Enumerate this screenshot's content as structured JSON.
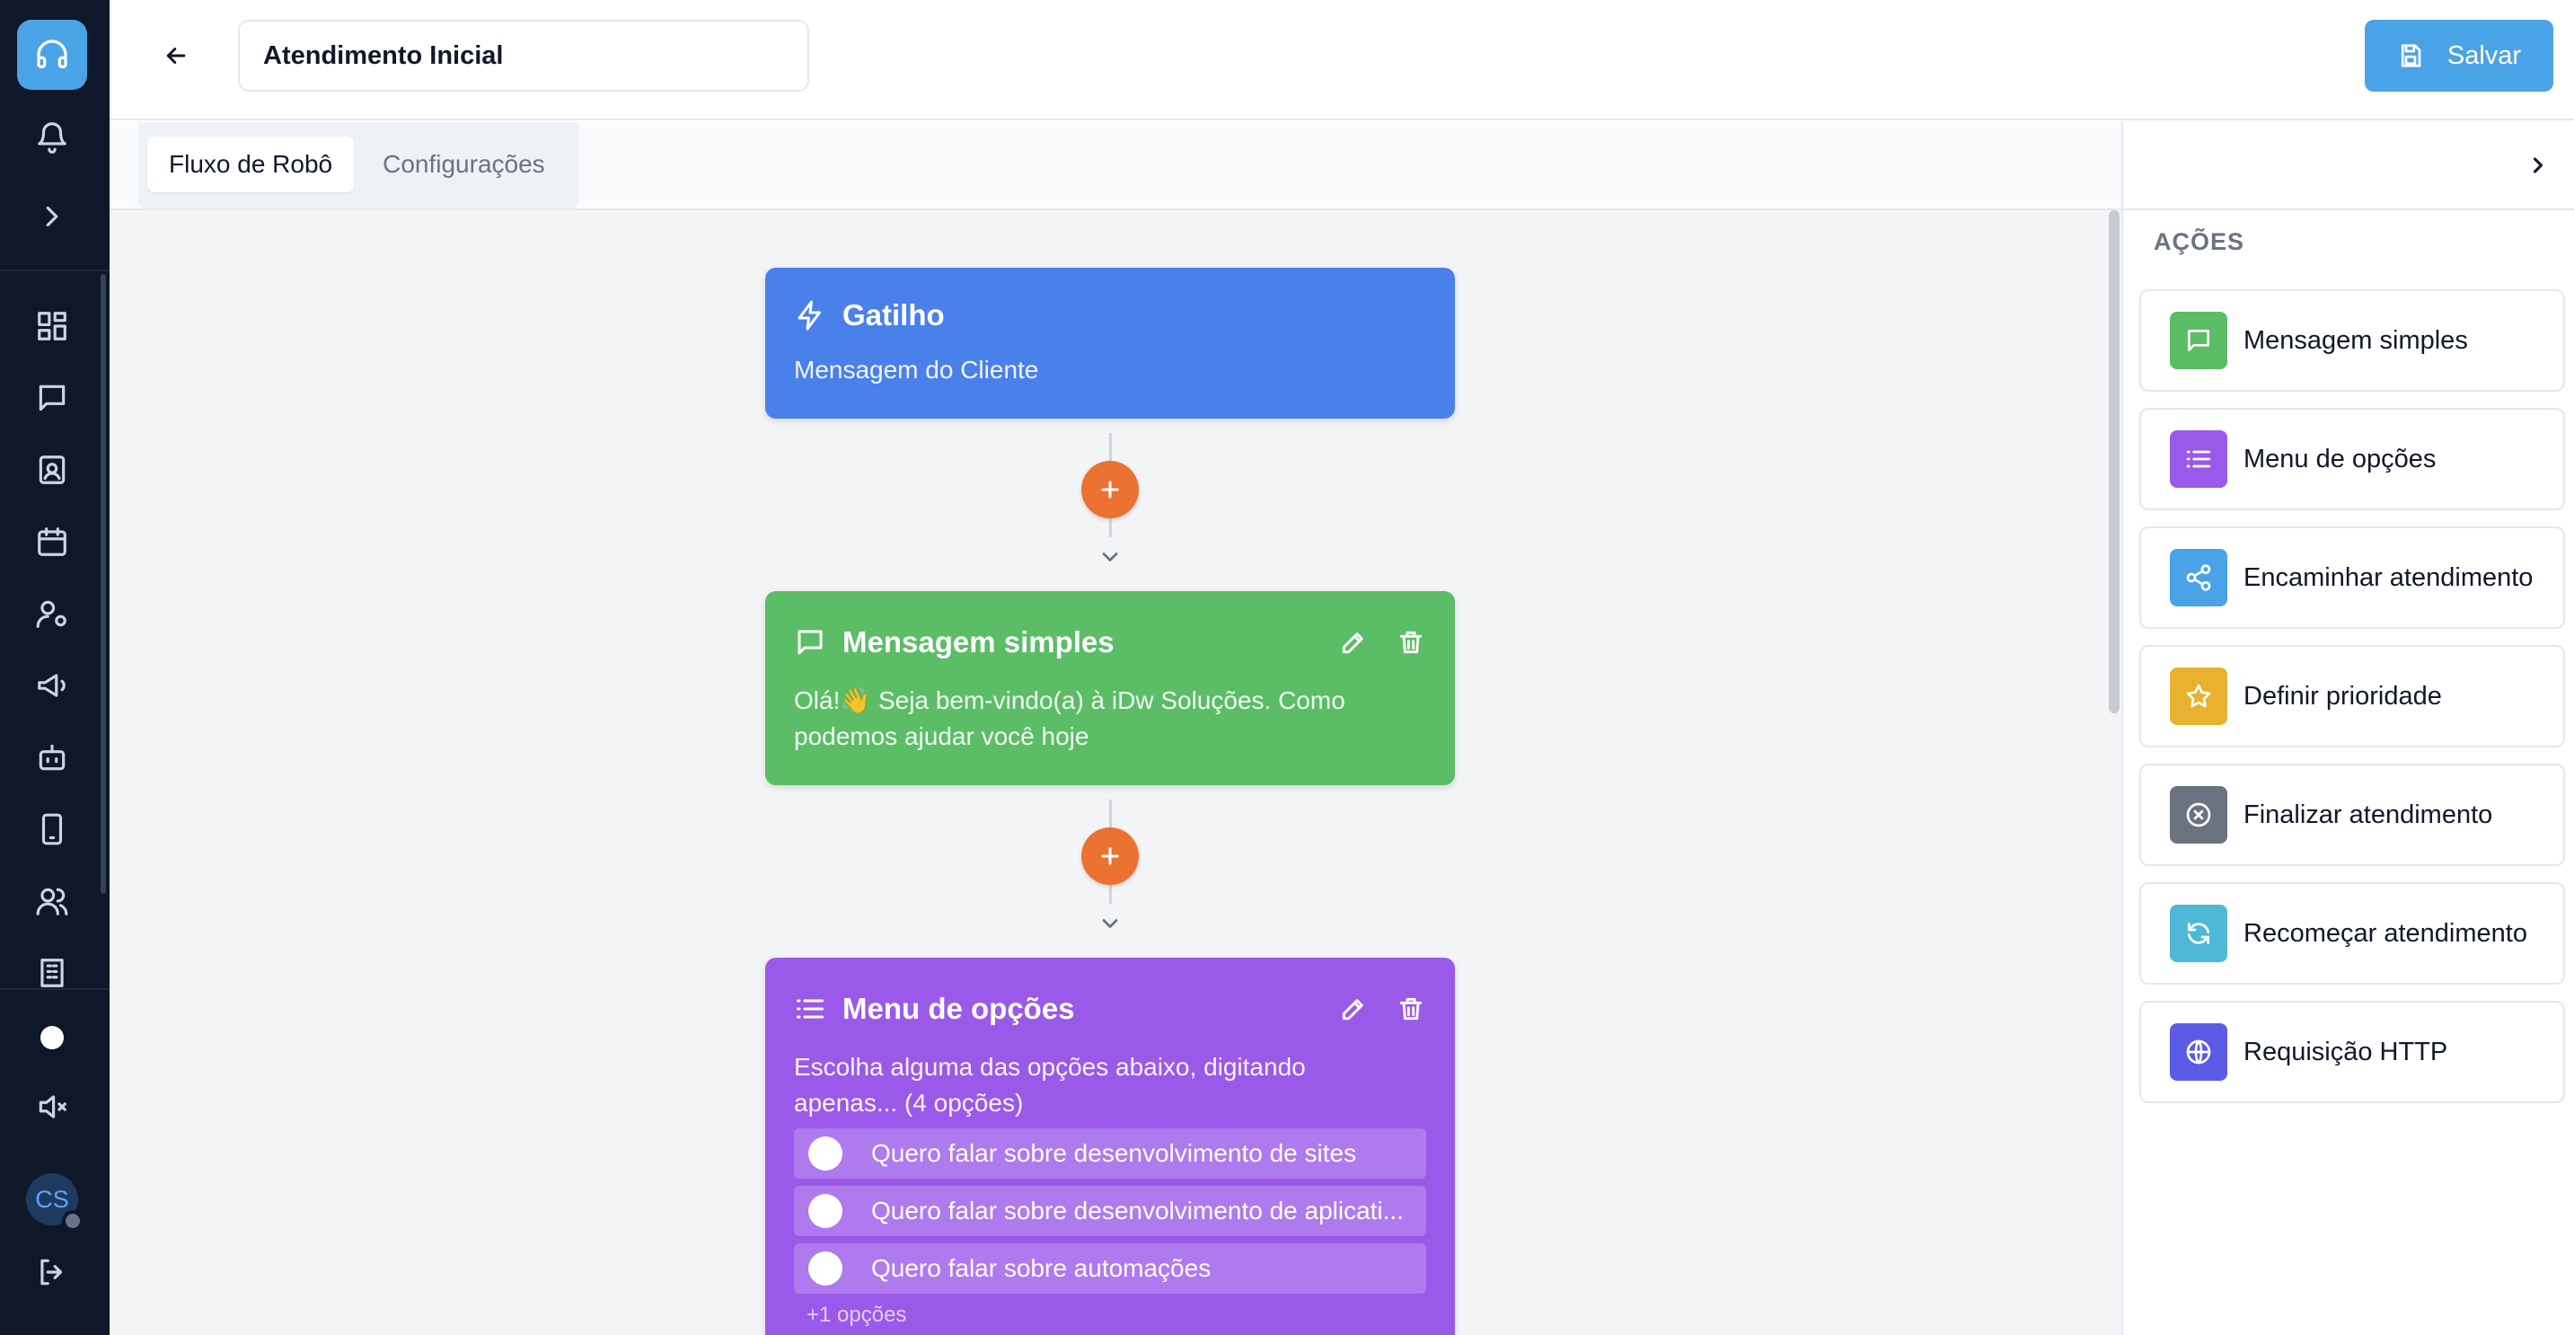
{
  "sidebar": {
    "logo_icon": "headset-icon",
    "avatar_initials": "CS",
    "items": [
      {
        "name": "bell-icon"
      },
      {
        "name": "chevron-right-icon"
      },
      {
        "name": "dashboard-icon"
      },
      {
        "name": "chat-icon"
      },
      {
        "name": "contacts-icon"
      },
      {
        "name": "calendar-icon"
      },
      {
        "name": "user-settings-icon"
      },
      {
        "name": "megaphone-icon"
      },
      {
        "name": "bot-icon"
      },
      {
        "name": "phone-icon"
      },
      {
        "name": "users-icon"
      },
      {
        "name": "building-icon"
      },
      {
        "name": "volume-mute-icon"
      },
      {
        "name": "logout-icon"
      }
    ]
  },
  "header": {
    "flow_name": "Atendimento Inicial",
    "save_label": "Salvar"
  },
  "tabs": [
    {
      "label": "Fluxo de Robô",
      "active": true
    },
    {
      "label": "Configurações",
      "active": false
    }
  ],
  "flow": {
    "trigger": {
      "title": "Gatilho",
      "description": "Mensagem do Cliente",
      "color": "#4a80ea"
    },
    "message": {
      "title": "Mensagem simples",
      "text": "Olá!👋 Seja bem-vindo(a) à iDw Soluções. Como podemos ajudar você hoje",
      "color": "#5bbd66"
    },
    "menu": {
      "title": "Menu de opções",
      "text": "Escolha alguma das opções abaixo, digitando apenas... (4 opções)",
      "color": "#9b59e9",
      "options": [
        "Quero falar sobre desenvolvimento de sites",
        "Quero falar sobre desenvolvimento de aplicati...",
        "Quero falar sobre automações"
      ],
      "more_options": "+1 opções"
    }
  },
  "actions_panel": {
    "title": "AÇÕES",
    "items": [
      {
        "label": "Mensagem simples",
        "icon": "message-icon",
        "color": "#5bbd66"
      },
      {
        "label": "Menu de opções",
        "icon": "list-icon",
        "color": "#9b59e9"
      },
      {
        "label": "Encaminhar atendimento",
        "icon": "share-icon",
        "color": "#4ba3e7"
      },
      {
        "label": "Definir prioridade",
        "icon": "star-icon",
        "color": "#e8b130"
      },
      {
        "label": "Finalizar atendimento",
        "icon": "close-circle-icon",
        "color": "#6b7280"
      },
      {
        "label": "Recomeçar atendimento",
        "icon": "refresh-icon",
        "color": "#4fb8d6"
      },
      {
        "label": "Requisição HTTP",
        "icon": "globe-icon",
        "color": "#5b5be6"
      }
    ]
  }
}
